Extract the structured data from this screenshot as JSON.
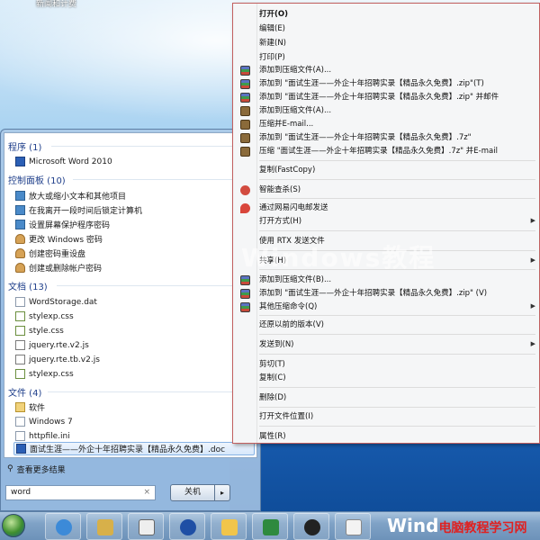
{
  "desktop": {
    "label": "新闻和计费"
  },
  "start_menu": {
    "sections": [
      {
        "title": "程序 (1)",
        "items": [
          "Microsoft Word 2010"
        ]
      },
      {
        "title": "控制面板 (10)",
        "items": [
          "放大或缩小文本和其他项目",
          "在我离开一段时间后锁定计算机",
          "设置屏幕保护程序密码",
          "更改 Windows 密码",
          "创建密码重设盘",
          "创建或删除帐户密码"
        ]
      },
      {
        "title": "文档 (13)",
        "items": [
          "WordStorage.dat",
          "stylexp.css",
          "style.css",
          "jquery.rte.v2.js",
          "jquery.rte.tb.v2.js",
          "stylexp.css"
        ]
      },
      {
        "title": "文件 (4)",
        "items": [
          "软件",
          "Windows 7",
          "httpfile.ini",
          "面试生涯——外企十年招聘实录【精品永久免费】.doc"
        ]
      }
    ],
    "more_results": "查看更多结果",
    "search": {
      "value": "word",
      "clear": "×"
    },
    "shutdown": {
      "label": "关机",
      "arrow": "▸"
    }
  },
  "context_menu": {
    "items": [
      "打开(O)",
      "编辑(E)",
      "新建(N)",
      "打印(P)",
      "添加到压缩文件(A)...",
      "添加到 \"面试生涯——外企十年招聘实录【精品永久免费】.zip\"(T)",
      "添加到 \"面试生涯——外企十年招聘实录【精品永久免费】.zip\" 并邮件",
      "添加到压缩文件(A)...",
      "压缩并E-mail...",
      "添加到 \"面试生涯——外企十年招聘实录【精品永久免费】.7z\"",
      "压缩 \"面试生涯——外企十年招聘实录【精品永久免费】.7z\" 并E-mail",
      "复制(FastCopy)",
      "智能查杀(S)",
      "通过网易闪电邮发送",
      "打开方式(H)",
      "使用 RTX 发送文件",
      "共享(H)",
      "添加到压缩文件(B)...",
      "添加到 \"面试生涯——外企十年招聘实录【精品永久免费】.zip\" (V)",
      "其他压缩命令(Q)",
      "还原以前的版本(V)",
      "发送到(N)",
      "剪切(T)",
      "复制(C)",
      "删除(D)",
      "打开文件位置(I)",
      "属性(R)"
    ],
    "submenu_arrow": "▶"
  },
  "watermark": "Windows教程",
  "brand": {
    "main": "Wind",
    "sub": "电脑教程学习网"
  },
  "taskbar": {
    "pinned": [
      "ie-icon",
      "photoshop-icon",
      "pen-tool-icon",
      "media-player-icon",
      "folder-icon",
      "excel-icon",
      "qq-icon",
      "mail-icon"
    ]
  }
}
